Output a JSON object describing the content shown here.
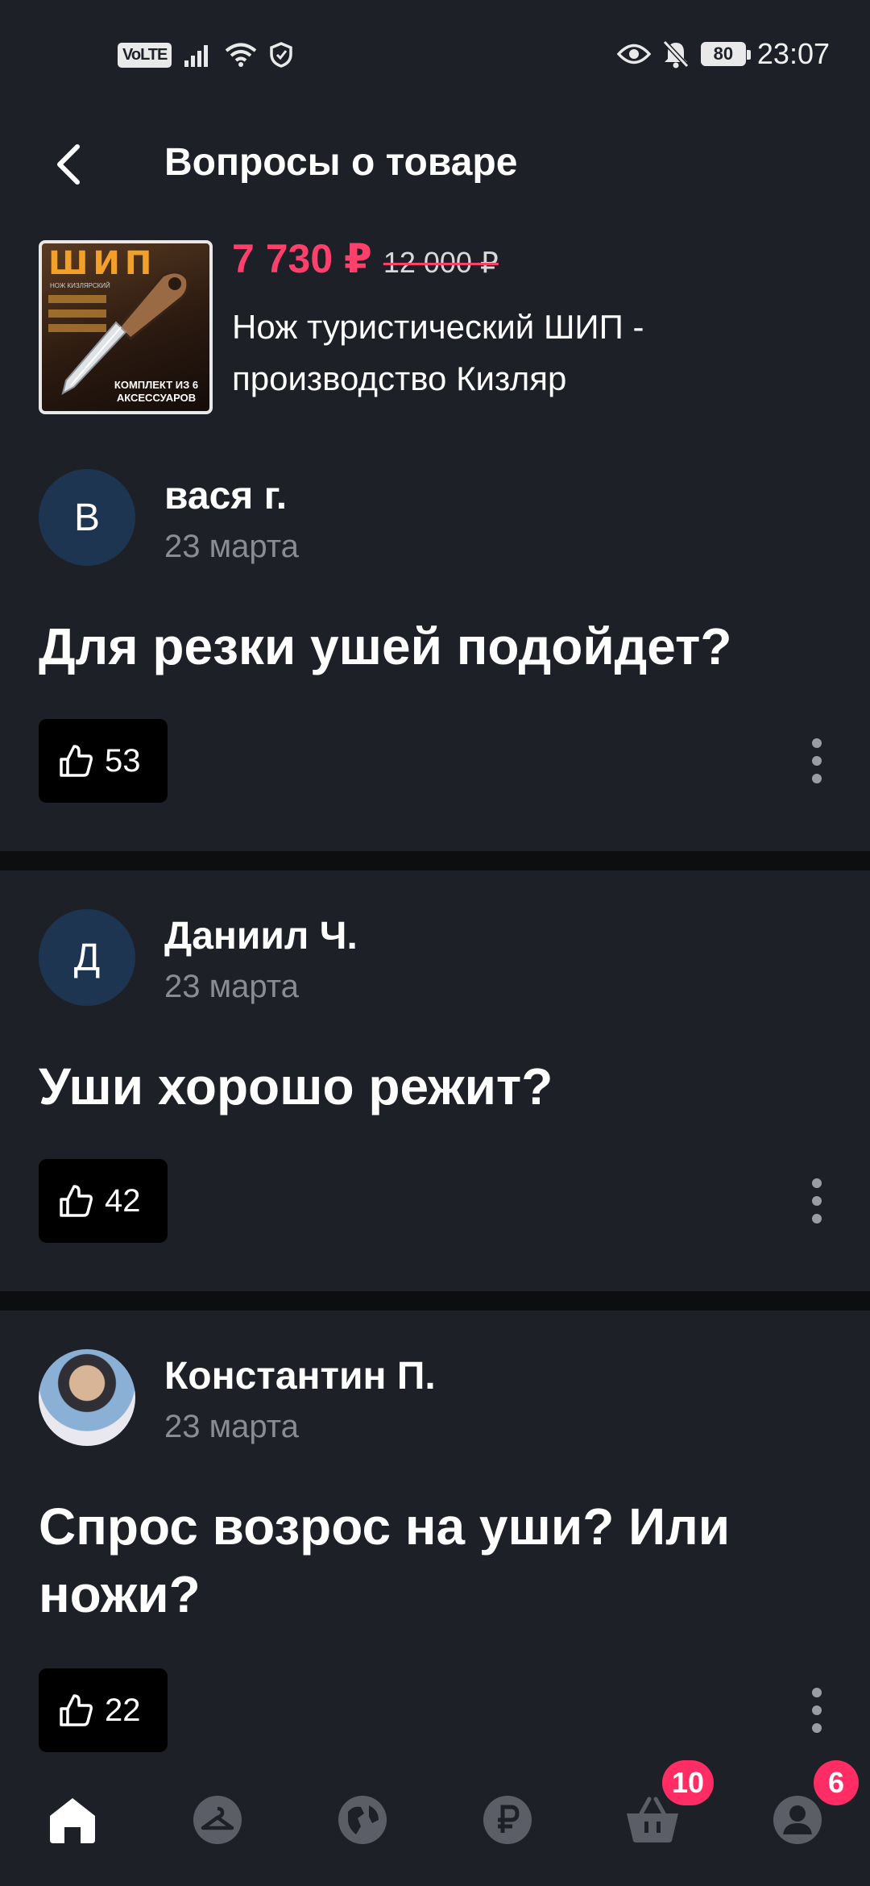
{
  "status_bar": {
    "network_label": "VoLTE",
    "battery_level": "80",
    "time": "23:07"
  },
  "header": {
    "title": "Вопросы о товаре"
  },
  "product": {
    "price_current": "7 730 ₽",
    "price_old": "12 000 ₽",
    "name": "Нож туристический ШИП - производство Кизляр",
    "thumb_title": "ШИП",
    "thumb_subtitle": "НОЖ КИЗЛЯРСКИЙ",
    "thumb_badge": "КОМПЛЕКТ ИЗ 6 АКСЕССУАРОВ"
  },
  "questions": [
    {
      "avatar_letter": "В",
      "author": "вася г.",
      "date": "23 марта",
      "text": "Для резки ушей подойдет?",
      "likes": "53"
    },
    {
      "avatar_letter": "Д",
      "author": "Даниил Ч.",
      "date": "23 марта",
      "text": "Уши хорошо режит?",
      "likes": "42"
    },
    {
      "avatar_letter": "",
      "author": "Константин П.",
      "date": "23 марта",
      "text": "Спрос возрос на уши? Или ножи?",
      "likes": "22"
    }
  ],
  "bottom_nav": {
    "items": [
      {
        "icon": "home-icon",
        "active": true
      },
      {
        "icon": "hanger-icon",
        "active": false
      },
      {
        "icon": "globe-icon",
        "active": false
      },
      {
        "icon": "ruble-icon",
        "active": false
      },
      {
        "icon": "basket-icon",
        "active": false,
        "badge": "10"
      },
      {
        "icon": "profile-icon",
        "active": false,
        "badge": "6"
      }
    ]
  },
  "colors": {
    "background": "#1e2027",
    "accent": "#ff3f6c",
    "badge": "#ff2d63",
    "avatar": "#1d3550"
  }
}
